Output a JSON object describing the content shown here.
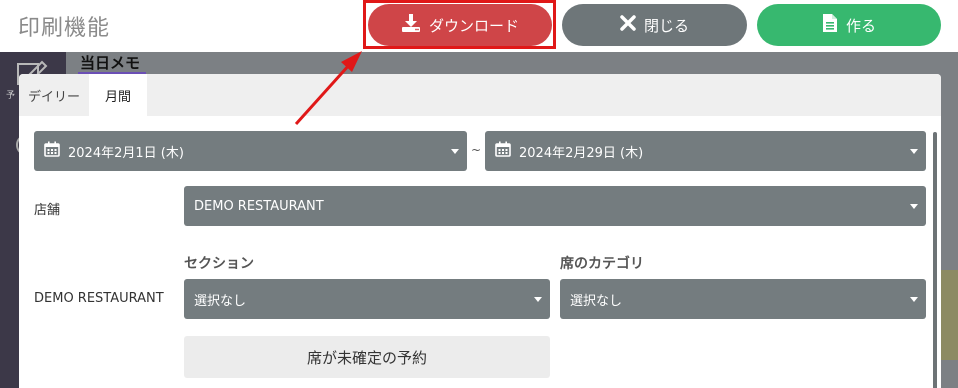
{
  "header": {
    "title": "印刷機能",
    "download_label": "ダウンロード",
    "close_label": "閉じる",
    "create_label": "作る"
  },
  "background": {
    "memo_title": "当日メモ",
    "sidebar_label": "予"
  },
  "tabs": [
    {
      "label": "デイリー",
      "active": false
    },
    {
      "label": "月間",
      "active": true
    }
  ],
  "date_range": {
    "start": "2024年2月1日 (木)",
    "separator": "~",
    "end": "2024年2月29日 (木)"
  },
  "store": {
    "label": "店舗",
    "value": "DEMO RESTAURANT"
  },
  "filters": {
    "restaurant_label": "DEMO RESTAURANT",
    "section_heading": "セクション",
    "section_value": "選択なし",
    "category_heading": "席のカテゴリ",
    "category_value": "選択なし"
  },
  "unassigned_label": "席が未確定の予約",
  "colors": {
    "download": "#cf4548",
    "close": "#6e7679",
    "create": "#37b86f",
    "select_bg": "#747c7f",
    "highlight": "#e01818"
  }
}
